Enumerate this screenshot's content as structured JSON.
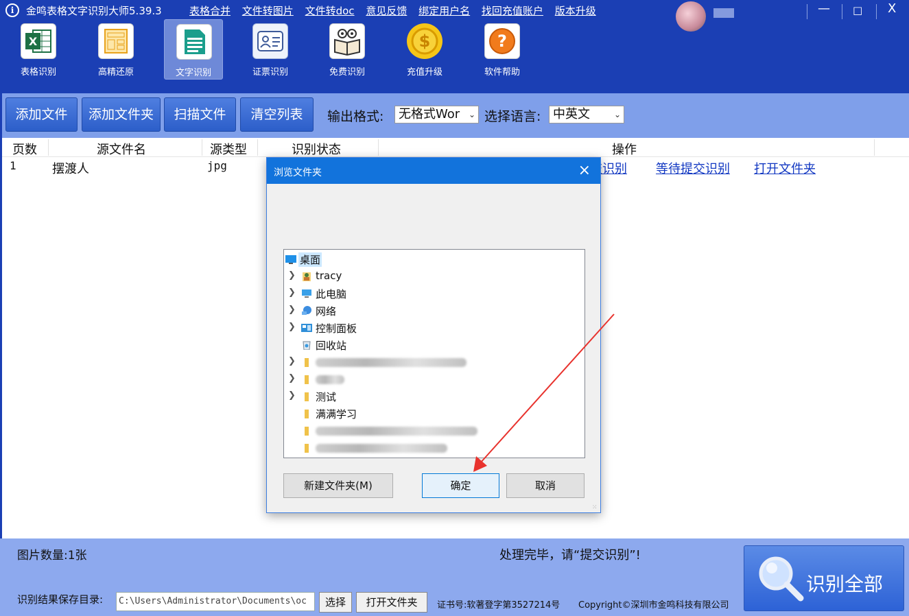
{
  "app": {
    "title": "金鸣表格文字识别大师5.39.3",
    "logo_glyph": "i",
    "top_links": [
      "表格合并",
      "文件转图片",
      "文件转doc",
      "意见反馈",
      "绑定用户名",
      "找回充值账户",
      "版本升级"
    ],
    "window_controls": {
      "minimize": "—",
      "maximize": "□",
      "close": "X"
    }
  },
  "tools": [
    {
      "label": "表格识别",
      "icon": "excel-icon"
    },
    {
      "label": "高精还原",
      "icon": "layout-icon"
    },
    {
      "label": "文字识别",
      "icon": "document-icon",
      "active": true
    },
    {
      "label": "证票识别",
      "icon": "id-card-icon"
    },
    {
      "label": "免费识别",
      "icon": "book-icon"
    },
    {
      "label": "充值升级",
      "icon": "coin-icon"
    },
    {
      "label": "软件帮助",
      "icon": "help-icon"
    }
  ],
  "toolbar": {
    "add_file": "添加文件",
    "add_folder": "添加文件夹",
    "scan_file": "扫描文件",
    "clear_list": "清空列表",
    "output_format_label": "输出格式:",
    "output_format_value": "无格式Wor",
    "language_label": "选择语言:",
    "language_value": "中英文"
  },
  "table": {
    "headers": [
      "页数",
      "源文件名",
      "源类型",
      "识别状态",
      "操作"
    ],
    "rows": [
      {
        "page": "1",
        "name": "摆渡人",
        "type": "jpg",
        "actions": [
          "提交识别",
          "等待提交识别",
          "打开文件夹"
        ]
      }
    ]
  },
  "dialog": {
    "title": "浏览文件夹",
    "close": "×",
    "tree": [
      {
        "label": "桌面",
        "icon": "desktop-icon",
        "selected": true,
        "expandable": false
      },
      {
        "label": "tracy",
        "icon": "user-folder-icon",
        "expandable": true
      },
      {
        "label": "此电脑",
        "icon": "computer-icon",
        "expandable": true
      },
      {
        "label": "网络",
        "icon": "network-icon",
        "expandable": true
      },
      {
        "label": "控制面板",
        "icon": "control-panel-icon",
        "expandable": true
      },
      {
        "label": "回收站",
        "icon": "recycle-bin-icon",
        "expandable": false
      },
      {
        "label": "",
        "icon": "folder-icon",
        "expandable": true,
        "blurred": true
      },
      {
        "label": "",
        "icon": "folder-icon",
        "expandable": true,
        "blurred": true
      },
      {
        "label": "测试",
        "icon": "folder-icon",
        "expandable": true
      },
      {
        "label": "满满学习",
        "icon": "folder-icon",
        "expandable": false
      },
      {
        "label": "",
        "icon": "folder-icon",
        "expandable": false,
        "blurred": true
      },
      {
        "label": "",
        "icon": "folder-icon",
        "expandable": false,
        "blurred": true
      }
    ],
    "new_folder": "新建文件夹(M)",
    "ok": "确定",
    "cancel": "取消"
  },
  "bottom": {
    "image_count": "图片数量:1张",
    "status_message": "处理完毕，请“提交识别”!",
    "save_dir_label": "识别结果保存目录:",
    "save_dir_value": "C:\\Users\\Administrator\\Documents\\oc",
    "choose": "选择",
    "open_folder": "打开文件夹",
    "cert": "证书号:软著登字第3527214号",
    "copyright": "Copyright©深圳市金鸣科技有限公司",
    "recognize_all": "识别全部"
  },
  "colors": {
    "header_bg": "#1B3FB4",
    "toolbar_bg": "#7F9FEA",
    "bottom_bg": "#8DA9EE",
    "link": "#1238c2",
    "dialog_title": "#1273dc",
    "arrow": "#e8322d"
  }
}
